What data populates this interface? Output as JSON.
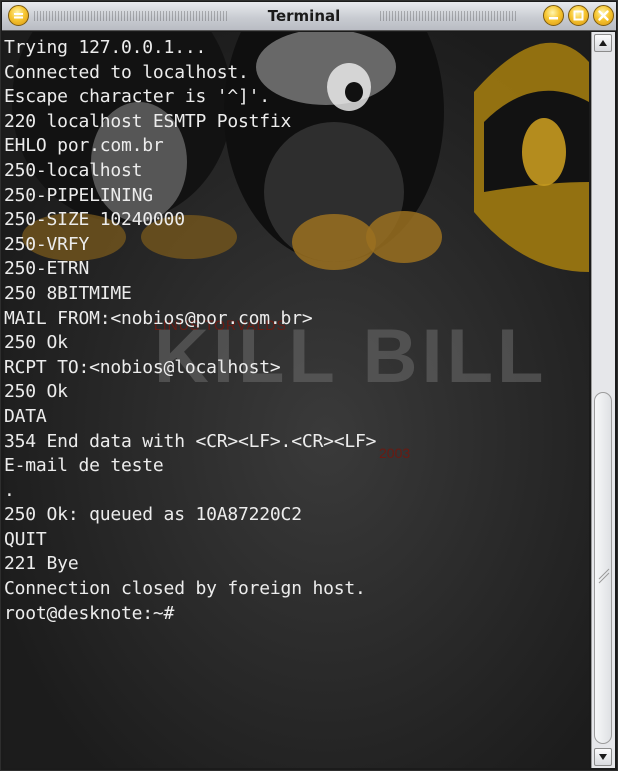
{
  "window": {
    "title": "Terminal",
    "buttons": [
      "menu",
      "minimize",
      "maximize",
      "close"
    ]
  },
  "terminal": {
    "lines": [
      "Trying 127.0.0.1...",
      "Connected to localhost.",
      "Escape character is '^]'.",
      "220 localhost ESMTP Postfix",
      "EHLO por.com.br",
      "250-localhost",
      "250-PIPELINING",
      "250-SIZE 10240000",
      "250-VRFY",
      "250-ETRN",
      "250 8BITMIME",
      "MAIL FROM:<nobios@por.com.br>",
      "250 Ok",
      "RCPT TO:<nobios@localhost>",
      "250 Ok",
      "DATA",
      "354 End data with <CR><LF>.<CR><LF>",
      "E-mail de teste",
      ".",
      "250 Ok: queued as 10A87220C2",
      "QUIT",
      "221 Bye",
      "Connection closed by foreign host.",
      "root@desknote:~#"
    ],
    "wallpaper_text": {
      "big": "KILL BILL",
      "small": "LINUS TORVALDS",
      "year": "2003"
    }
  },
  "colors": {
    "terminal_bg": "#1d1d1d",
    "terminal_fg": "#ececec",
    "button_yellow": "#f7c631"
  }
}
